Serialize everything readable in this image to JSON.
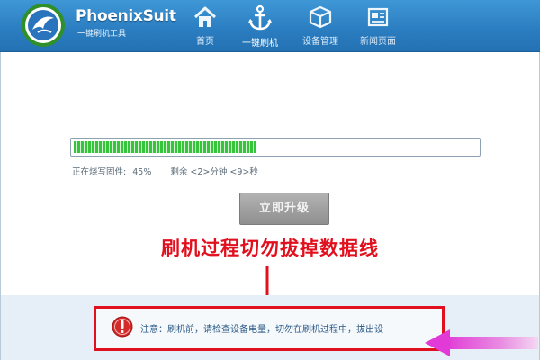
{
  "app": {
    "name": "PhoenixSuit",
    "subtitle": "一键刷机工具"
  },
  "nav": {
    "items": [
      {
        "label": "首页",
        "icon": "home-icon"
      },
      {
        "label": "一键刷机",
        "icon": "anchor-icon",
        "active": true
      },
      {
        "label": "设备管理",
        "icon": "cube-icon"
      },
      {
        "label": "新闻页面",
        "icon": "news-icon"
      }
    ]
  },
  "progress": {
    "value_fraction": 0.45,
    "status_label": "正在烧写固件:",
    "percent_text": "45%",
    "remaining_text": "剩余 <2>分钟 <9>秒"
  },
  "upgrade_button": {
    "label": "立即升级"
  },
  "annotation": {
    "text": "刷机过程切勿拔掉数据线",
    "color": "#e1101e"
  },
  "notice": {
    "text": "注意：刷机前，请检查设备电量，切勿在刷机过程中，拔出设",
    "icon": "warning-icon"
  },
  "colors": {
    "header": "#2a7dc0",
    "progress": "#35c43a",
    "highlight": "#e1101e",
    "pointer_arrow": "#e23ad6"
  }
}
